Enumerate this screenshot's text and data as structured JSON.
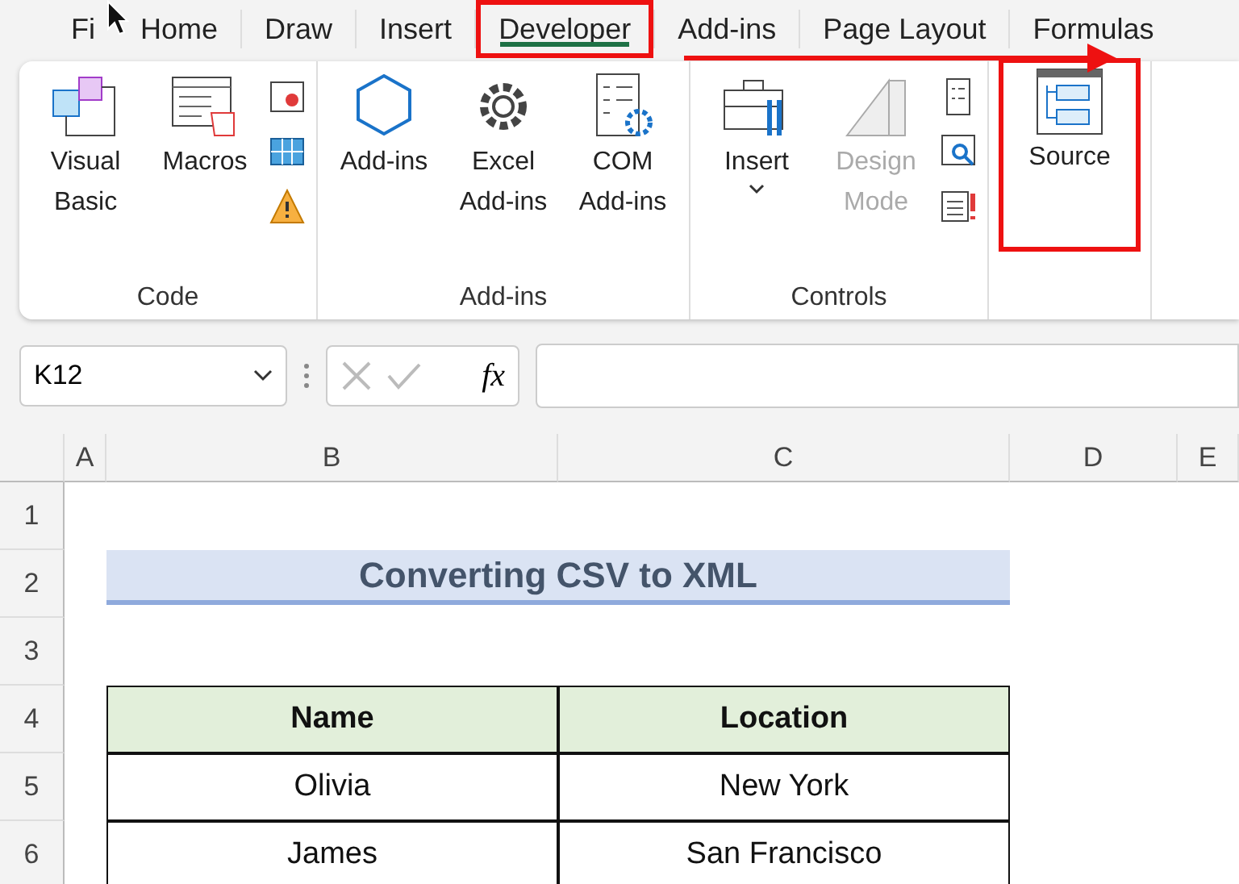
{
  "tabs": [
    {
      "label": "Fi",
      "selected": false,
      "highlighted": false
    },
    {
      "label": "Home",
      "selected": false,
      "highlighted": false
    },
    {
      "label": "Draw",
      "selected": false,
      "highlighted": false
    },
    {
      "label": "Insert",
      "selected": false,
      "highlighted": false
    },
    {
      "label": "Developer",
      "selected": true,
      "highlighted": true
    },
    {
      "label": "Add-ins",
      "selected": false,
      "highlighted": false
    },
    {
      "label": "Page Layout",
      "selected": false,
      "highlighted": false
    },
    {
      "label": "Formulas",
      "selected": false,
      "highlighted": false
    }
  ],
  "ribbon_groups": [
    {
      "label": "Code",
      "highlighted": false,
      "items": [
        {
          "kind": "large",
          "label": "Visual Basic",
          "disabled": false,
          "has_menu": false
        },
        {
          "kind": "large",
          "label": "Macros",
          "disabled": false,
          "has_menu": false
        },
        {
          "kind": "small"
        },
        {
          "kind": "small"
        },
        {
          "kind": "small"
        }
      ]
    },
    {
      "label": "Add-ins",
      "highlighted": false,
      "items": [
        {
          "kind": "large",
          "label": "Add-ins",
          "disabled": false,
          "has_menu": false
        },
        {
          "kind": "large",
          "label": "Excel Add-ins",
          "disabled": false,
          "has_menu": false
        },
        {
          "kind": "large",
          "label": "COM Add-ins",
          "disabled": false,
          "has_menu": false
        }
      ]
    },
    {
      "label": "Controls",
      "highlighted": false,
      "items": [
        {
          "kind": "large",
          "label": "Insert",
          "disabled": false,
          "has_menu": true
        },
        {
          "kind": "large",
          "label": "Design Mode",
          "disabled": true,
          "has_menu": false
        },
        {
          "kind": "small"
        },
        {
          "kind": "small"
        },
        {
          "kind": "small"
        }
      ]
    },
    {
      "highlighted": true,
      "items": [
        {
          "kind": "large",
          "label": "Source",
          "disabled": false,
          "has_menu": false
        }
      ]
    }
  ],
  "formula_bar": {
    "name_box": "K12",
    "function_label": "fx"
  },
  "sheet": {
    "columns": [
      "A",
      "B",
      "C",
      "D",
      "E"
    ],
    "rows": [
      {
        "number": "1",
        "cells": []
      },
      {
        "number": "2",
        "cells": [
          {
            "kind": "empty",
            "text": ""
          },
          {
            "kind": "title",
            "text": "Converting CSV to XML"
          }
        ]
      },
      {
        "number": "3",
        "cells": []
      },
      {
        "number": "4",
        "cells": [
          {
            "kind": "empty",
            "text": ""
          },
          {
            "kind": "header",
            "text": "Name"
          },
          {
            "kind": "header",
            "text": "Location"
          }
        ]
      },
      {
        "number": "5",
        "cells": [
          {
            "kind": "empty",
            "text": ""
          },
          {
            "kind": "data",
            "text": "Olivia"
          },
          {
            "kind": "data",
            "text": "New York"
          }
        ]
      },
      {
        "number": "6",
        "cells": [
          {
            "kind": "empty",
            "text": ""
          },
          {
            "kind": "data",
            "text": "James"
          },
          {
            "kind": "data",
            "text": "San Francisco"
          }
        ]
      }
    ]
  }
}
